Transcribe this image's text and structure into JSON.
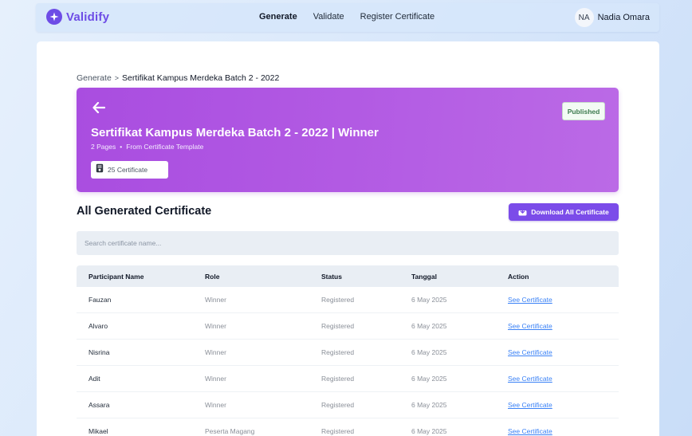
{
  "app": {
    "name": "Validify",
    "logo_icon": "sparkle-icon",
    "brand_color": "#6d4ce6"
  },
  "nav": {
    "links": [
      {
        "label": "Generate",
        "active": true
      },
      {
        "label": "Validate",
        "active": false
      },
      {
        "label": "Register Certificate",
        "active": false
      }
    ]
  },
  "user": {
    "initials": "NA",
    "name": "Nadia Omara"
  },
  "breadcrumb": {
    "parent": "Generate",
    "separator": ">",
    "current": "Sertifikat Kampus Merdeka Batch 2 - 2022"
  },
  "hero": {
    "back_icon": "arrow-left-icon",
    "title": "Sertifikat Kampus Merdeka Batch 2 - 2022 | Winner",
    "pages": "2 Pages",
    "source": "From Certificate Template",
    "meta_separator": "•",
    "count_label": "25 Certificate",
    "status": "Published",
    "gradient_colors": [
      "#a94de0",
      "#bb6ae6"
    ]
  },
  "section": {
    "title": "All Generated Certificate",
    "download_label": "Download All Certificate",
    "download_icon": "download-icon"
  },
  "search": {
    "placeholder": "Search certificate name...",
    "value": ""
  },
  "table": {
    "headers": [
      "Participant Name",
      "Role",
      "Status",
      "Tanggal",
      "Action"
    ],
    "rows": [
      {
        "name": "Fauzan",
        "role": "Winner",
        "status": "Registered",
        "date": "6 May 2025",
        "action": "See Certificate"
      },
      {
        "name": "Alvaro",
        "role": "Winner",
        "status": "Registered",
        "date": "6 May 2025",
        "action": "See Certificate"
      },
      {
        "name": "Nisrina",
        "role": "Winner",
        "status": "Registered",
        "date": "6 May 2025",
        "action": "See Certificate"
      },
      {
        "name": "Adit",
        "role": "Winner",
        "status": "Registered",
        "date": "6 May 2025",
        "action": "See Certificate"
      },
      {
        "name": "Assara",
        "role": "Winner",
        "status": "Registered",
        "date": "6 May 2025",
        "action": "See Certificate"
      },
      {
        "name": "Mikael",
        "role": "Peserta Magang",
        "status": "Registered",
        "date": "6 May 2025",
        "action": "See Certificate"
      }
    ]
  }
}
